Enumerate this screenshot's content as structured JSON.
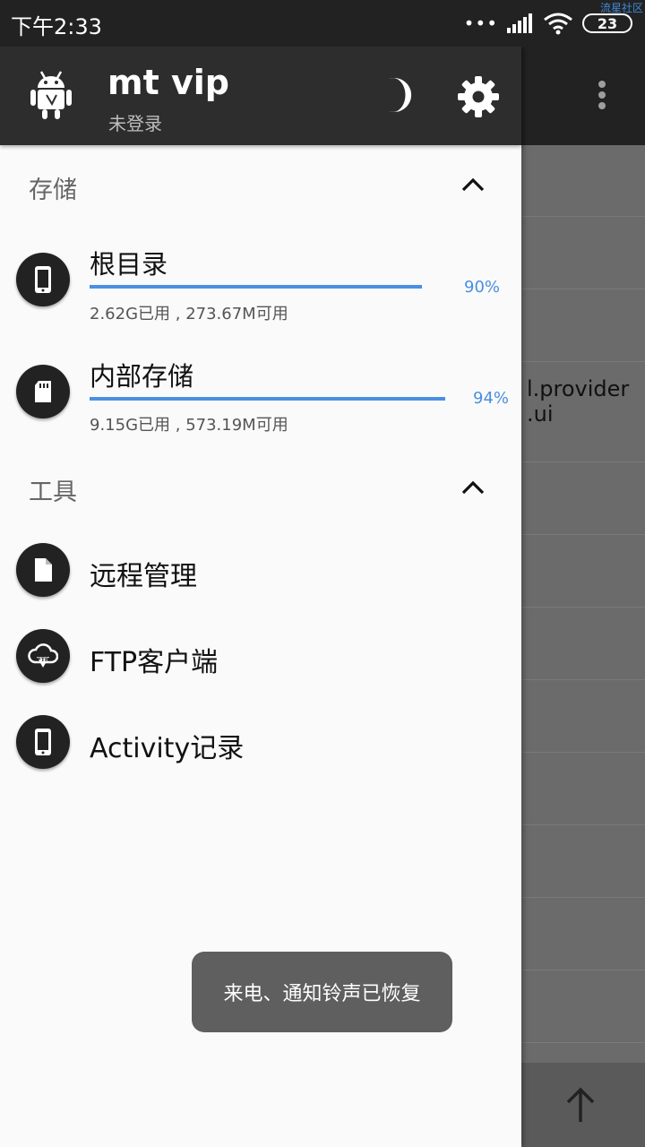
{
  "status_bar": {
    "time": "下午2:33",
    "dots": "•••",
    "battery_level": "23",
    "watermark": "流星社区"
  },
  "background": {
    "list_text_line1": "l.provider",
    "list_text_line2": ".ui"
  },
  "drawer": {
    "header": {
      "app_name": "mt vip",
      "login_status": "未登录"
    },
    "storage": {
      "title": "存储",
      "items": [
        {
          "title": "根目录",
          "percent_label": "90%",
          "percent": 90,
          "usage": "2.62G已用 , 273.67M可用",
          "icon": "phone-icon"
        },
        {
          "title": "内部存储",
          "percent_label": "94%",
          "percent": 94,
          "usage": "9.15G已用 , 573.19M可用",
          "icon": "sd-card-icon"
        }
      ]
    },
    "tools": {
      "title": "工具",
      "items": [
        {
          "label": "远程管理",
          "icon": "file-icon"
        },
        {
          "label": "FTP客户端",
          "icon": "ftp-cloud-icon"
        },
        {
          "label": "Activity记录",
          "icon": "phone-icon"
        }
      ]
    }
  },
  "toast": {
    "message": "来电、通知铃声已恢复"
  },
  "colors": {
    "accent": "#4a8fe0",
    "header": "#2d2d2d",
    "drawer_bg": "#fafafa"
  }
}
